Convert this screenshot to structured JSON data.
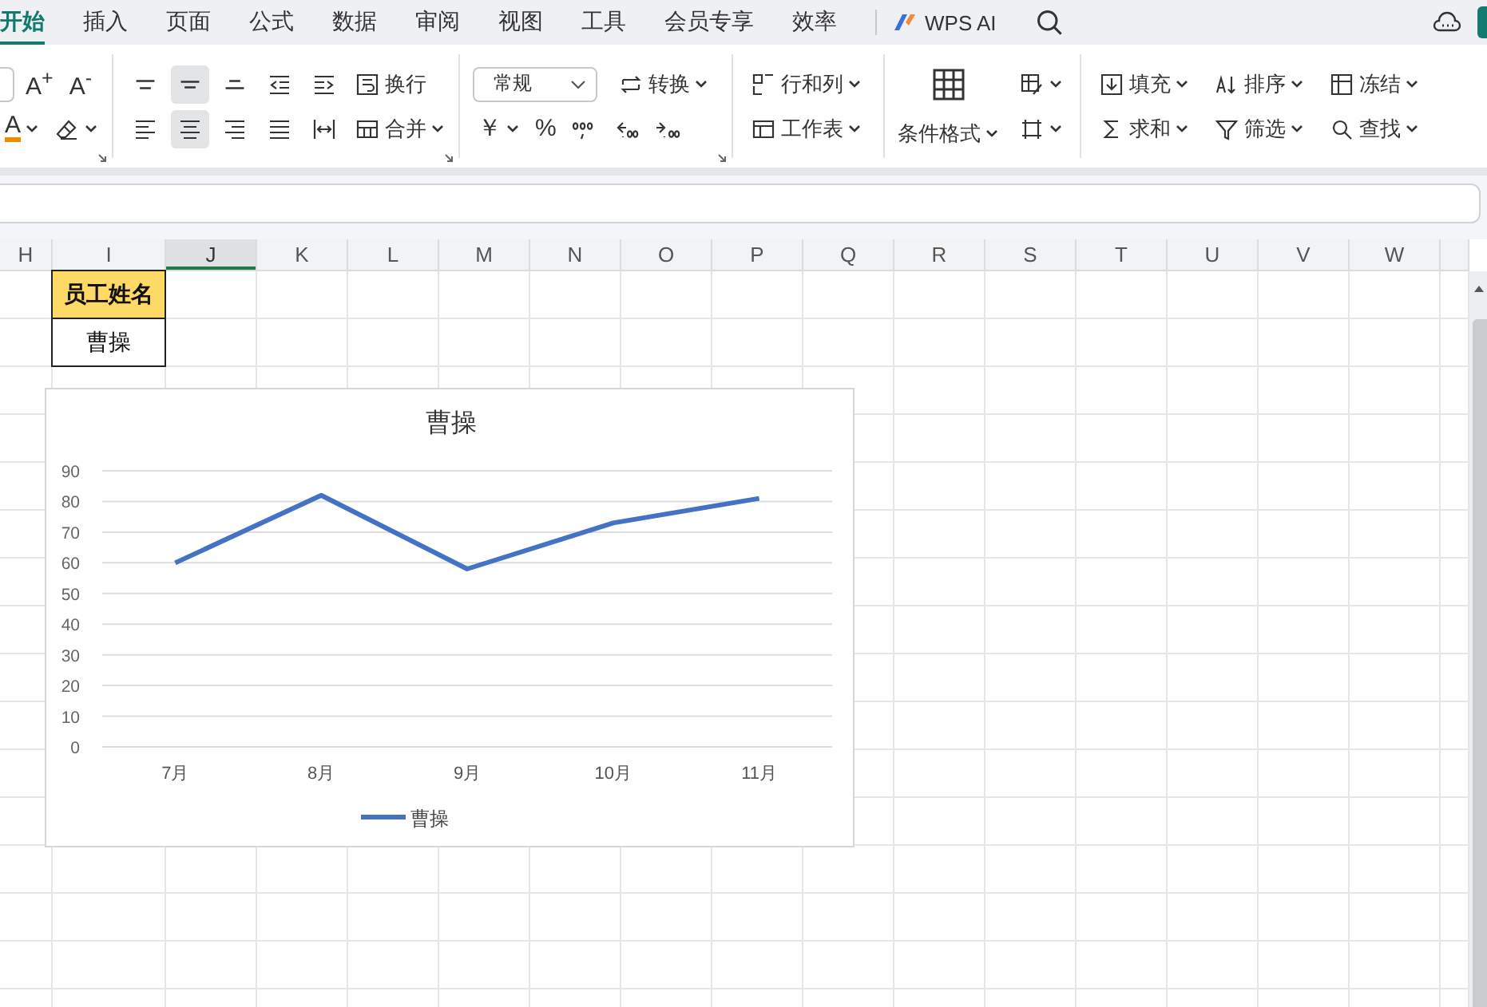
{
  "tabs": [
    {
      "label": "开始",
      "selected": true
    },
    {
      "label": "插入",
      "selected": false
    },
    {
      "label": "页面",
      "selected": false
    },
    {
      "label": "公式",
      "selected": false
    },
    {
      "label": "数据",
      "selected": false
    },
    {
      "label": "审阅",
      "selected": false
    },
    {
      "label": "视图",
      "selected": false
    },
    {
      "label": "工具",
      "selected": false
    },
    {
      "label": "会员专享",
      "selected": false
    },
    {
      "label": "效率",
      "selected": false
    }
  ],
  "ai_button": {
    "label": "WPS AI"
  },
  "ribbon": {
    "groups": [
      {
        "rows": [
          [
            {
              "kind": "field"
            },
            {
              "kind": "text",
              "label": "A$^{+}$"
            },
            {
              "kind": "text",
              "label": "A$^{-}$"
            }
          ],
          [
            {
              "kind": "font-color",
              "label": "A",
              "dropdown": true
            },
            {
              "kind": "eraser",
              "dropdown": true
            }
          ]
        ]
      },
      {
        "rows": [
          [
            {
              "kind": "align-top",
              "selected": false
            },
            {
              "kind": "align-middle",
              "selected": true
            },
            {
              "kind": "align-bottom",
              "selected": false
            },
            {
              "kind": "indent-decrease",
              "selected": false
            },
            {
              "kind": "indent-increase",
              "selected": false
            },
            {
              "kind": "wrap",
              "label": "换行",
              "selected": false
            }
          ],
          [
            {
              "kind": "align-left",
              "selected": false
            },
            {
              "kind": "align-center",
              "selected": true
            },
            {
              "kind": "align-right",
              "selected": false
            },
            {
              "kind": "justify",
              "selected": false
            },
            {
              "kind": "distribute",
              "selected": false
            },
            {
              "kind": "merge",
              "label": "合并",
              "dropdown": true,
              "selected": false
            }
          ]
        ]
      },
      {
        "rows": [
          [
            {
              "kind": "select",
              "label": "常规"
            },
            {
              "kind": "convert",
              "label": "转换",
              "dropdown": true
            }
          ],
          [
            {
              "kind": "text",
              "label": "￥",
              "dropdown": true
            },
            {
              "kind": "text",
              "label": "%"
            },
            {
              "kind": "comma"
            },
            {
              "kind": "dec-decrease"
            },
            {
              "kind": "dec-increase"
            }
          ]
        ]
      },
      {
        "rows": [
          [
            {
              "kind": "rows-cols",
              "label": "行和列",
              "dropdown": true
            }
          ],
          [
            {
              "kind": "sheet",
              "label": "工作表",
              "dropdown": true
            }
          ]
        ]
      },
      {
        "big": {
          "kind": "cond-format",
          "label": "条件格式",
          "dropdown": true
        },
        "rows": [
          [
            {
              "kind": "cell-style",
              "dropdown": true
            }
          ],
          [
            {
              "kind": "border",
              "dropdown": true
            }
          ]
        ]
      },
      {
        "rows": [
          [
            {
              "kind": "fill",
              "label": "填充",
              "dropdown": true
            },
            {
              "kind": "sort",
              "label": "排序",
              "dropdown": true
            },
            {
              "kind": "freeze",
              "label": "冻结",
              "dropdown": true
            }
          ],
          [
            {
              "kind": "sum",
              "label": "求和",
              "dropdown": true
            },
            {
              "kind": "filter",
              "label": "筛选",
              "dropdown": true
            },
            {
              "kind": "find",
              "label": "查找",
              "dropdown": true
            }
          ]
        ]
      }
    ]
  },
  "columns": [
    {
      "label": "H",
      "selected": false
    },
    {
      "label": "I",
      "selected": false,
      "cells": [
        {
          "text": "员工姓名",
          "kind": "header"
        },
        {
          "text": "曹操",
          "kind": "plain"
        }
      ]
    },
    {
      "label": "J",
      "selected": true
    },
    {
      "label": "K",
      "selected": false
    },
    {
      "label": "L",
      "selected": false
    },
    {
      "label": "M",
      "selected": false
    },
    {
      "label": "N",
      "selected": false
    },
    {
      "label": "O",
      "selected": false
    },
    {
      "label": "P",
      "selected": false
    },
    {
      "label": "Q",
      "selected": false
    },
    {
      "label": "R",
      "selected": false
    },
    {
      "label": "S",
      "selected": false
    },
    {
      "label": "T",
      "selected": false
    },
    {
      "label": "U",
      "selected": false
    },
    {
      "label": "V",
      "selected": false
    },
    {
      "label": "W",
      "selected": false
    }
  ],
  "chart": {
    "chart_data": {
      "type": "line",
      "title": "曹操",
      "categories": [
        "7月",
        "8月",
        "9月",
        "10月",
        "11月"
      ],
      "series": [
        {
          "name": "曹操",
          "color": "#4472c4",
          "values": [
            60,
            82,
            58,
            73,
            81
          ]
        }
      ],
      "ylim": [
        0,
        90
      ],
      "grid": true,
      "yticks": [
        0,
        10,
        20,
        30,
        40,
        50,
        60,
        70,
        80,
        90
      ]
    }
  }
}
